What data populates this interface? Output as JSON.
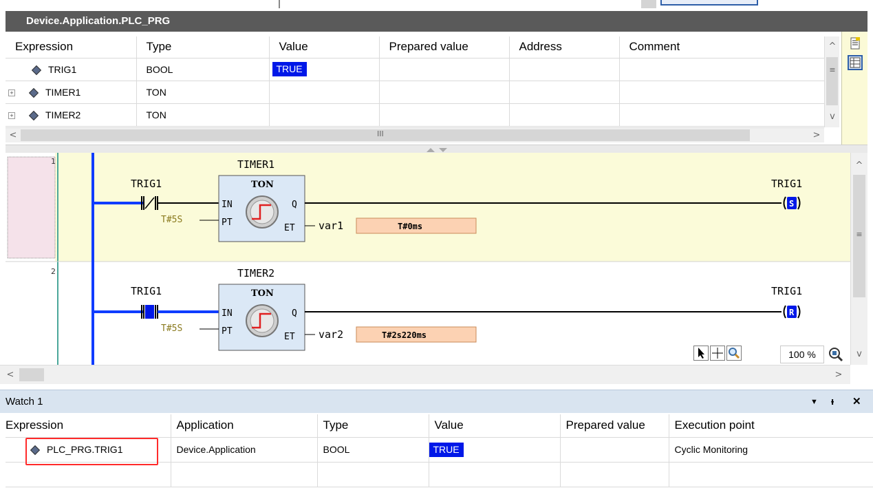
{
  "editor": {
    "title": "Device.Application.PLC_PRG"
  },
  "var_table": {
    "columns": [
      "Expression",
      "Type",
      "Value",
      "Prepared value",
      "Address",
      "Comment"
    ],
    "rows": [
      {
        "expression": "TRIG1",
        "type": "BOOL",
        "value": "TRUE",
        "expandable": false
      },
      {
        "expression": "TIMER1",
        "type": "TON",
        "value": "",
        "expandable": true
      },
      {
        "expression": "TIMER2",
        "type": "TON",
        "value": "",
        "expandable": true
      }
    ],
    "scrollbar_thumb_glyph": "III"
  },
  "ladder": {
    "networks": [
      {
        "number": "1",
        "contact_label": "TRIG1",
        "contact_kind": "negated-contact",
        "block_instance": "TIMER1",
        "block_type": "TON",
        "pin_in": "IN",
        "pin_pt": "PT",
        "pin_q": "Q",
        "pin_et": "ET",
        "pt_value": "T#5S",
        "et_variable": "var1",
        "et_value": "T#0ms",
        "coil_label": "TRIG1",
        "coil_kind": "S",
        "highlight_color": "#fbfbd9"
      },
      {
        "number": "2",
        "contact_label": "TRIG1",
        "contact_kind": "active-contact",
        "block_instance": "TIMER2",
        "block_type": "TON",
        "pin_in": "IN",
        "pin_pt": "PT",
        "pin_q": "Q",
        "pin_et": "ET",
        "pt_value": "T#5S",
        "et_variable": "var2",
        "et_value": "T#2s220ms",
        "coil_label": "TRIG1",
        "coil_kind": "R"
      }
    ],
    "zoom": "100 %",
    "tool_icons": [
      "pointer-icon",
      "pan-icon",
      "magnifier-icon"
    ]
  },
  "watch": {
    "title": "Watch 1",
    "columns": [
      "Expression",
      "Application",
      "Type",
      "Value",
      "Prepared value",
      "Execution point"
    ],
    "rows": [
      {
        "expression": "PLC_PRG.TRIG1",
        "application": "Device.Application",
        "type": "BOOL",
        "value": "TRUE",
        "prepared": "",
        "execution_point": "Cyclic Monitoring"
      },
      {
        "expression": "",
        "application": "",
        "type": "",
        "value": "",
        "prepared": "",
        "execution_point": ""
      }
    ],
    "controls": {
      "dropdown": "▼",
      "pin": "ᵻ",
      "close": "✕"
    }
  },
  "colors": {
    "true_value_bg": "#0018e8",
    "rail_blue": "#0f3cff",
    "et_value_bg": "#fcd2b3",
    "block_bg": "#dbe8f6",
    "highlight_box": "#ff2a2a"
  }
}
